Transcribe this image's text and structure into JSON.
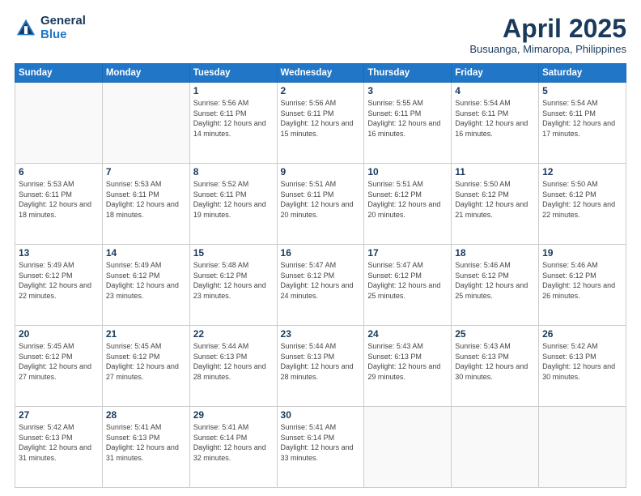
{
  "logo": {
    "general": "General",
    "blue": "Blue"
  },
  "title": "April 2025",
  "location": "Busuanga, Mimaropa, Philippines",
  "days_of_week": [
    "Sunday",
    "Monday",
    "Tuesday",
    "Wednesday",
    "Thursday",
    "Friday",
    "Saturday"
  ],
  "weeks": [
    [
      {
        "day": "",
        "info": ""
      },
      {
        "day": "",
        "info": ""
      },
      {
        "day": "1",
        "info": "Sunrise: 5:56 AM\nSunset: 6:11 PM\nDaylight: 12 hours and 14 minutes."
      },
      {
        "day": "2",
        "info": "Sunrise: 5:56 AM\nSunset: 6:11 PM\nDaylight: 12 hours and 15 minutes."
      },
      {
        "day": "3",
        "info": "Sunrise: 5:55 AM\nSunset: 6:11 PM\nDaylight: 12 hours and 16 minutes."
      },
      {
        "day": "4",
        "info": "Sunrise: 5:54 AM\nSunset: 6:11 PM\nDaylight: 12 hours and 16 minutes."
      },
      {
        "day": "5",
        "info": "Sunrise: 5:54 AM\nSunset: 6:11 PM\nDaylight: 12 hours and 17 minutes."
      }
    ],
    [
      {
        "day": "6",
        "info": "Sunrise: 5:53 AM\nSunset: 6:11 PM\nDaylight: 12 hours and 18 minutes."
      },
      {
        "day": "7",
        "info": "Sunrise: 5:53 AM\nSunset: 6:11 PM\nDaylight: 12 hours and 18 minutes."
      },
      {
        "day": "8",
        "info": "Sunrise: 5:52 AM\nSunset: 6:11 PM\nDaylight: 12 hours and 19 minutes."
      },
      {
        "day": "9",
        "info": "Sunrise: 5:51 AM\nSunset: 6:11 PM\nDaylight: 12 hours and 20 minutes."
      },
      {
        "day": "10",
        "info": "Sunrise: 5:51 AM\nSunset: 6:12 PM\nDaylight: 12 hours and 20 minutes."
      },
      {
        "day": "11",
        "info": "Sunrise: 5:50 AM\nSunset: 6:12 PM\nDaylight: 12 hours and 21 minutes."
      },
      {
        "day": "12",
        "info": "Sunrise: 5:50 AM\nSunset: 6:12 PM\nDaylight: 12 hours and 22 minutes."
      }
    ],
    [
      {
        "day": "13",
        "info": "Sunrise: 5:49 AM\nSunset: 6:12 PM\nDaylight: 12 hours and 22 minutes."
      },
      {
        "day": "14",
        "info": "Sunrise: 5:49 AM\nSunset: 6:12 PM\nDaylight: 12 hours and 23 minutes."
      },
      {
        "day": "15",
        "info": "Sunrise: 5:48 AM\nSunset: 6:12 PM\nDaylight: 12 hours and 23 minutes."
      },
      {
        "day": "16",
        "info": "Sunrise: 5:47 AM\nSunset: 6:12 PM\nDaylight: 12 hours and 24 minutes."
      },
      {
        "day": "17",
        "info": "Sunrise: 5:47 AM\nSunset: 6:12 PM\nDaylight: 12 hours and 25 minutes."
      },
      {
        "day": "18",
        "info": "Sunrise: 5:46 AM\nSunset: 6:12 PM\nDaylight: 12 hours and 25 minutes."
      },
      {
        "day": "19",
        "info": "Sunrise: 5:46 AM\nSunset: 6:12 PM\nDaylight: 12 hours and 26 minutes."
      }
    ],
    [
      {
        "day": "20",
        "info": "Sunrise: 5:45 AM\nSunset: 6:12 PM\nDaylight: 12 hours and 27 minutes."
      },
      {
        "day": "21",
        "info": "Sunrise: 5:45 AM\nSunset: 6:12 PM\nDaylight: 12 hours and 27 minutes."
      },
      {
        "day": "22",
        "info": "Sunrise: 5:44 AM\nSunset: 6:13 PM\nDaylight: 12 hours and 28 minutes."
      },
      {
        "day": "23",
        "info": "Sunrise: 5:44 AM\nSunset: 6:13 PM\nDaylight: 12 hours and 28 minutes."
      },
      {
        "day": "24",
        "info": "Sunrise: 5:43 AM\nSunset: 6:13 PM\nDaylight: 12 hours and 29 minutes."
      },
      {
        "day": "25",
        "info": "Sunrise: 5:43 AM\nSunset: 6:13 PM\nDaylight: 12 hours and 30 minutes."
      },
      {
        "day": "26",
        "info": "Sunrise: 5:42 AM\nSunset: 6:13 PM\nDaylight: 12 hours and 30 minutes."
      }
    ],
    [
      {
        "day": "27",
        "info": "Sunrise: 5:42 AM\nSunset: 6:13 PM\nDaylight: 12 hours and 31 minutes."
      },
      {
        "day": "28",
        "info": "Sunrise: 5:41 AM\nSunset: 6:13 PM\nDaylight: 12 hours and 31 minutes."
      },
      {
        "day": "29",
        "info": "Sunrise: 5:41 AM\nSunset: 6:14 PM\nDaylight: 12 hours and 32 minutes."
      },
      {
        "day": "30",
        "info": "Sunrise: 5:41 AM\nSunset: 6:14 PM\nDaylight: 12 hours and 33 minutes."
      },
      {
        "day": "",
        "info": ""
      },
      {
        "day": "",
        "info": ""
      },
      {
        "day": "",
        "info": ""
      }
    ]
  ]
}
